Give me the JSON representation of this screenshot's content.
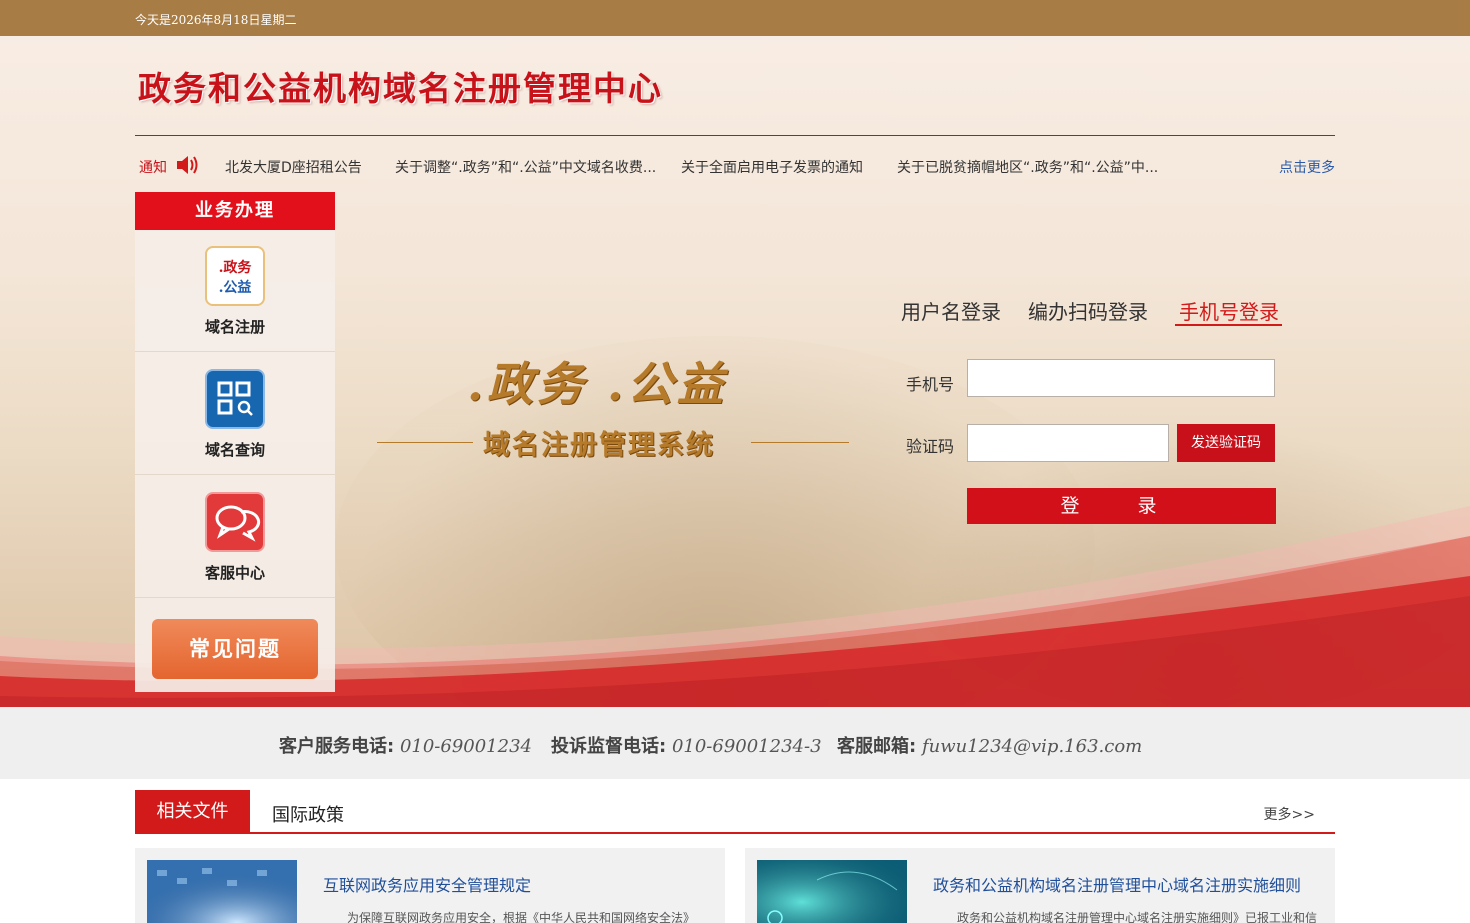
{
  "topbar": {
    "date": "今天是2026年8月18日星期二"
  },
  "header": {
    "site_title": "政务和公益机构域名注册管理中心"
  },
  "notice": {
    "label": "通知",
    "items": [
      "北发大厦D座招租公告",
      "关于调整“.政务”和“.公益”中文域名收费...",
      "关于全面启用电子发票的通知",
      "关于已脱贫摘帽地区“.政务”和“.公益”中..."
    ],
    "more": "点击更多"
  },
  "sidebar": {
    "title": "业务办理",
    "items": [
      {
        "label": "域名注册",
        "icon": "domain-register-icon",
        "icon_text_1": ".政务",
        "icon_text_2": ".公益"
      },
      {
        "label": "域名查询",
        "icon": "domain-query-icon"
      },
      {
        "label": "客服中心",
        "icon": "customer-service-icon"
      }
    ],
    "faq": "常见问题"
  },
  "banner": {
    "main": ".政务 .公益",
    "sub": "域名注册管理系统"
  },
  "login": {
    "tabs": [
      "用户名登录",
      "编办扫码登录",
      "手机号登录"
    ],
    "active_tab": "手机号登录",
    "phone_label": "手机号",
    "phone_value": "",
    "code_label": "验证码",
    "code_value": "",
    "send_code": "发送验证码",
    "submit": "登  录"
  },
  "contact": {
    "phone_key": "客户服务电话:",
    "phone_val": "010-69001234",
    "complaint_key": "投诉监督电话:",
    "complaint_val": "010-69001234-3",
    "email_key": "客服邮箱:",
    "email_val": "fuwu1234@vip.163.com"
  },
  "news": {
    "tabs": [
      "相关文件",
      "国际政策"
    ],
    "more": "更多>>",
    "cards": [
      {
        "title": "互联网政务应用安全管理规定",
        "desc": "为保障互联网政务应用安全，根据《中华人民共和国网络安全法》"
      },
      {
        "title": "政务和公益机构域名注册管理中心域名注册实施细则",
        "desc": "政务和公益机构域名注册管理中心域名注册实施细则》已报工业和信"
      }
    ]
  },
  "colors": {
    "brand_red": "#d21a1a",
    "topbar": "#a87d45",
    "link_blue": "#1f4f9a"
  }
}
